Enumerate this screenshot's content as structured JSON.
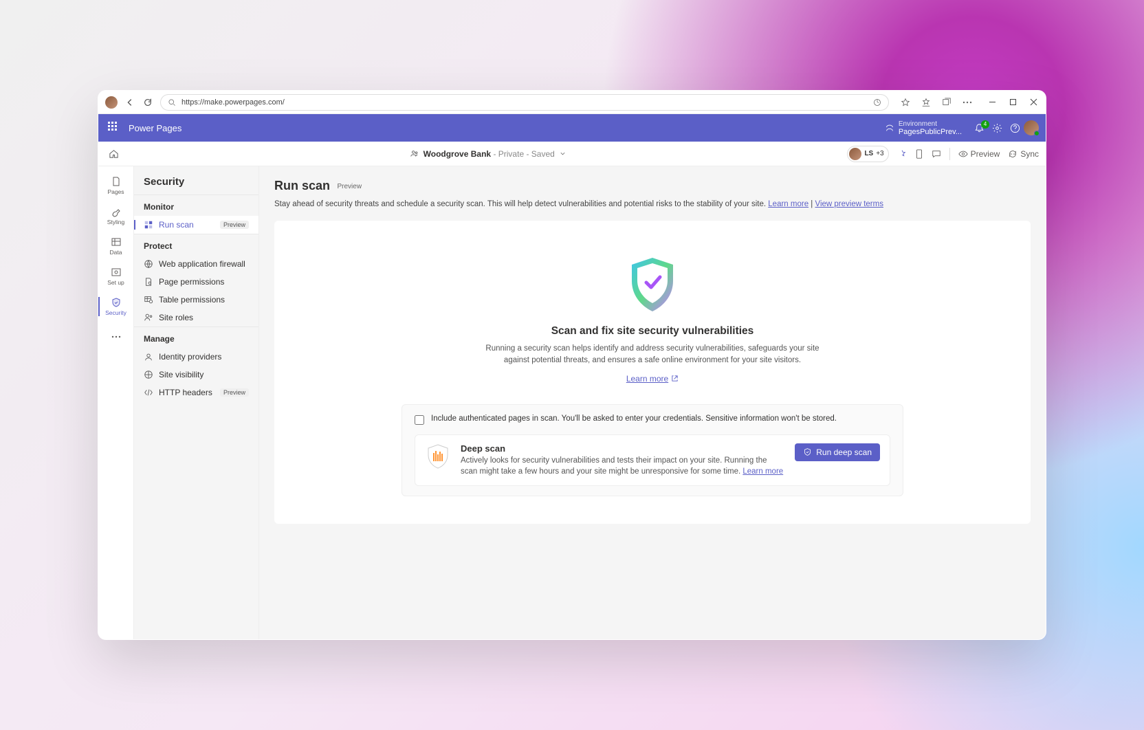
{
  "browser": {
    "url": "https://make.powerpages.com/",
    "icons": [
      "star",
      "favorite",
      "reader",
      "collections",
      "ellipsis",
      "minimize",
      "maximize",
      "close"
    ]
  },
  "appbar": {
    "title": "Power Pages",
    "env_label": "Environment",
    "env_value": "PagesPublicPrev...",
    "notification_count": "4"
  },
  "cmdbar": {
    "site_name": "Woodgrove Bank",
    "site_status": "- Private - Saved",
    "pill_label": "LS",
    "pill_extra": "+3",
    "preview": "Preview",
    "sync": "Sync"
  },
  "rail": [
    {
      "label": "Pages",
      "icon": "page"
    },
    {
      "label": "Styling",
      "icon": "brush"
    },
    {
      "label": "Data",
      "icon": "table"
    },
    {
      "label": "Set up",
      "icon": "gear"
    },
    {
      "label": "Security",
      "icon": "shield",
      "active": true
    },
    {
      "label": "",
      "icon": "ellipsis"
    }
  ],
  "secnav": {
    "title": "Security",
    "groups": [
      {
        "label": "Monitor",
        "items": [
          {
            "label": "Run scan",
            "icon": "scan",
            "active": true,
            "badge": "Preview"
          }
        ]
      },
      {
        "label": "Protect",
        "items": [
          {
            "label": "Web application firewall",
            "icon": "firewall"
          },
          {
            "label": "Page permissions",
            "icon": "pageperm"
          },
          {
            "label": "Table permissions",
            "icon": "tableperm"
          },
          {
            "label": "Site roles",
            "icon": "roles"
          }
        ]
      },
      {
        "label": "Manage",
        "items": [
          {
            "label": "Identity providers",
            "icon": "identity"
          },
          {
            "label": "Site visibility",
            "icon": "visibility"
          },
          {
            "label": "HTTP headers",
            "icon": "headers",
            "badge": "Preview"
          }
        ]
      }
    ]
  },
  "main": {
    "heading": "Run scan",
    "heading_badge": "Preview",
    "desc_text": "Stay ahead of security threats and schedule a security scan. This will help detect vulnerabilities and potential risks to the stability of your site. ",
    "desc_link1": "Learn more",
    "desc_sep": " | ",
    "desc_link2": "View preview terms",
    "hero_title": "Scan and fix site security vulnerabilities",
    "hero_sub": "Running a security scan helps identify and address security vulnerabilities, safeguards your site against potential threats, and ensures a safe online environment for your site visitors.",
    "hero_learn": "Learn more",
    "checkbox_label": "Include authenticated pages in scan. You'll be asked to enter your credentials. Sensitive information won't be stored.",
    "deep_title": "Deep scan",
    "deep_desc": "Actively looks for security vulnerabilities and tests their impact on your site. Running the scan might take a few hours and your site might be unresponsive for some time. ",
    "deep_link": "Learn more",
    "run_button": "Run deep scan"
  }
}
